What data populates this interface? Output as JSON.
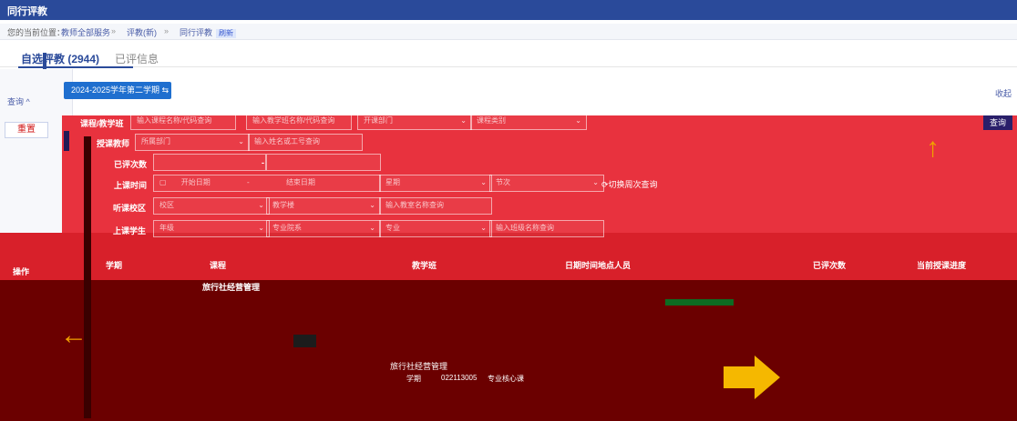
{
  "app": {
    "title": "同行评教"
  },
  "breadcrumb": {
    "prefix": "您的当前位置：",
    "items": [
      "教师全部服务",
      "评教(新)",
      "同行评教"
    ],
    "separator": "»",
    "badge": "刷新"
  },
  "tabs": [
    {
      "label": "自选评教 (2944)",
      "active": true
    },
    {
      "label": "已评信息"
    }
  ],
  "left_panel": {
    "collapse_label": "查询 ^",
    "reset_label": "重置"
  },
  "term_button": {
    "label": "2024-2025学年第二学期",
    "icon": "swap-icon"
  },
  "collapse_right": "收起",
  "query_button": "查询",
  "form": {
    "course_label": "课程/教学班",
    "course_placeholder": "输入课程名称/代码查询",
    "class_placeholder": "输入教学班名称/代码查询",
    "dept_placeholder": "开课部门",
    "coursetype_placeholder": "课程类别",
    "teacher_label": "授课教师",
    "teacher_dept_placeholder": "所属部门",
    "teacher_name_placeholder": "输入姓名或工号查询",
    "rated_label": "已评次数",
    "time_label": "上课时间",
    "start_date": "开始日期",
    "date_sep": "-",
    "end_date": "结束日期",
    "weekday_placeholder": "星期",
    "period_placeholder": "节次",
    "switch_week": "切换周次查询",
    "campus_label": "听课校区",
    "campus_placeholder": "校区",
    "building_placeholder": "教学楼",
    "classroom_placeholder": "输入教室名称查询",
    "student_label": "上课学生",
    "grade_placeholder": "年级",
    "major_dept_placeholder": "专业院系",
    "major_placeholder": "专业",
    "class_name_placeholder": "输入班级名称查询"
  },
  "table": {
    "headers": [
      "学期",
      "课程",
      "教学班",
      "日期时间地点人员",
      "已评次数",
      "当前授课进度"
    ],
    "ops_label": "操作",
    "rows": [
      {
        "course": "旅行社经营管理"
      },
      {
        "course": "旅行社经营管理",
        "year": "学期",
        "class": "022113005",
        "type": "专业核心课"
      }
    ]
  },
  "colors": {
    "brand": "#2a4a9a",
    "overlay_red": "#e8323e",
    "overlay_dark": "#6b0000",
    "arrow": "#f0a000"
  }
}
